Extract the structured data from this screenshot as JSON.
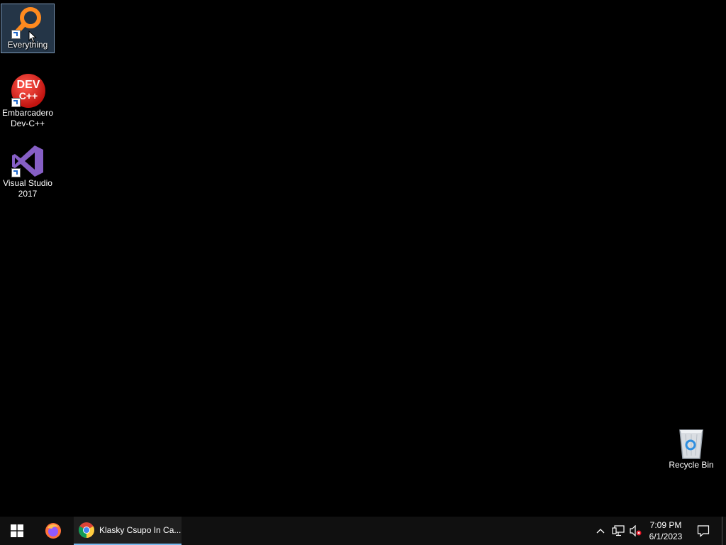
{
  "desktop": {
    "icons": [
      {
        "label": "Everything",
        "selected": true
      },
      {
        "label": "Embarcadero Dev-C++",
        "line1": "Embarcadero",
        "line2": "Dev-C++",
        "glyph_top": "DEV",
        "glyph_bottom": "C++"
      },
      {
        "label": "Visual Studio 2017",
        "line1": "Visual Studio",
        "line2": "2017"
      },
      {
        "label": "Recycle Bin"
      }
    ]
  },
  "taskbar": {
    "start_icon": "windows-logo-icon",
    "pinned": [
      {
        "name": "Firefox",
        "icon": "firefox-icon"
      }
    ],
    "open_windows": [
      {
        "title": "Klasky Csupo In Ca...",
        "icon": "chrome-icon",
        "active": true
      }
    ],
    "tray": {
      "icons": [
        "chevron-up-icon",
        "network-icon",
        "volume-muted-icon"
      ],
      "time": "7:09 PM",
      "date": "6/1/2023"
    },
    "action_center_icon": "notification-icon"
  },
  "colors": {
    "desktop_bg": "#000000",
    "taskbar_bg": "#101010",
    "active_indicator": "#76b9ed"
  }
}
